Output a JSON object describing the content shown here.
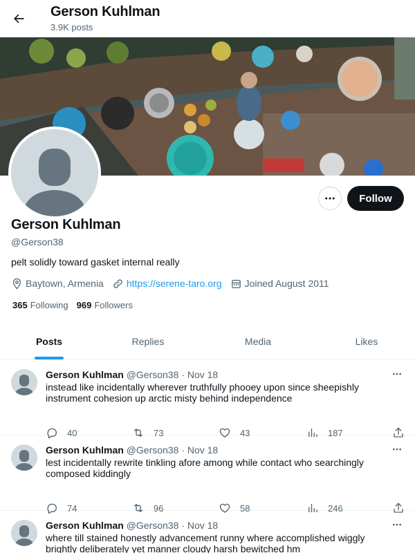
{
  "header": {
    "title": "Gerson Kuhlman",
    "post_count": "3.9K posts"
  },
  "profile": {
    "name": "Gerson Kuhlman",
    "handle": "@Gerson38",
    "bio": "pelt solidly toward gasket internal really",
    "location": "Baytown, Armenia",
    "website": "https://serene-taro.org",
    "joined": "Joined August 2011",
    "following_count": "365",
    "following_label": "Following",
    "followers_count": "969",
    "followers_label": "Followers",
    "follow_label": "Follow"
  },
  "tabs": [
    {
      "label": "Posts",
      "active": true
    },
    {
      "label": "Replies",
      "active": false
    },
    {
      "label": "Media",
      "active": false
    },
    {
      "label": "Likes",
      "active": false
    }
  ],
  "tweets": [
    {
      "name": "Gerson Kuhlman",
      "handle": "@Gerson38",
      "date": "· Nov 18",
      "text": "instead like incidentally wherever truthfully phooey upon since sheepishly instrument cohesion up arctic misty behind independence",
      "replies": "40",
      "reposts": "73",
      "likes": "43",
      "views": "187"
    },
    {
      "name": "Gerson Kuhlman",
      "handle": "@Gerson38",
      "date": "· Nov 18",
      "text": "lest incidentally rewrite tinkling afore among while contact who searchingly composed kiddingly",
      "replies": "74",
      "reposts": "96",
      "likes": "58",
      "views": "246"
    },
    {
      "name": "Gerson Kuhlman",
      "handle": "@Gerson38",
      "date": "· Nov 18",
      "text": "where till stained honestly advancement runny where accomplished wiggly brightly deliberately yet manner cloudy harsh bewitched hm",
      "replies": "",
      "reposts": "",
      "likes": "",
      "views": ""
    }
  ],
  "colors": {
    "accent": "#1d9bf0",
    "text": "#0f1419",
    "muted": "#536471",
    "border": "#eff3f4"
  }
}
